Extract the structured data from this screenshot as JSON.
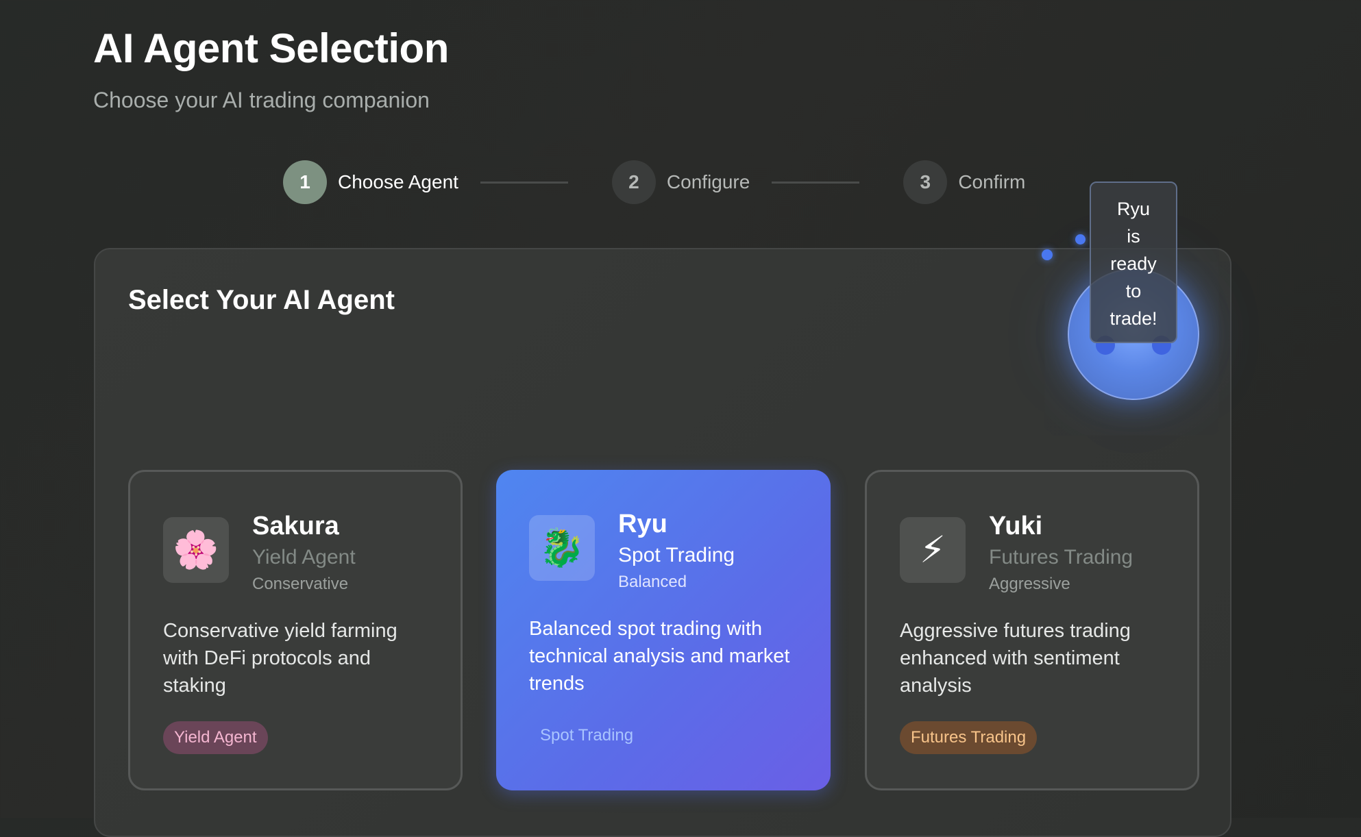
{
  "header": {
    "title": "AI Agent Selection",
    "subtitle": "Choose your AI trading companion"
  },
  "stepper": {
    "steps": [
      {
        "number": "1",
        "label": "Choose Agent",
        "active": true
      },
      {
        "number": "2",
        "label": "Configure",
        "active": false
      },
      {
        "number": "3",
        "label": "Confirm",
        "active": false
      }
    ]
  },
  "panel": {
    "title": "Select Your AI Agent"
  },
  "agents": [
    {
      "icon": "🌸",
      "icon_name": "cherry-blossom-icon",
      "name": "Sakura",
      "type": "Yield Agent",
      "risk": "Conservative",
      "description": "Conservative yield farming with DeFi protocols and staking",
      "tag": "Yield Agent",
      "selected": false
    },
    {
      "icon": "🐉",
      "icon_name": "dragon-icon",
      "name": "Ryu",
      "type": "Spot Trading",
      "risk": "Balanced",
      "description": "Balanced spot trading with technical analysis and market trends",
      "tag": "Spot Trading",
      "selected": true
    },
    {
      "icon": "⚡",
      "icon_name": "lightning-icon",
      "name": "Yuki",
      "type": "Futures Trading",
      "risk": "Aggressive",
      "description": "Aggressive futures trading enhanced with sentiment analysis",
      "tag": "Futures Trading",
      "selected": false
    }
  ],
  "assistant": {
    "message": "Ryu is ready to trade!"
  },
  "colors": {
    "background": "#272a28",
    "active_step": "#7d9181",
    "selected_card_start": "#4f86f0",
    "selected_card_end": "#6a5fe6",
    "yield_tag": "#f5b6d1",
    "futures_tag": "#f8c48a"
  }
}
